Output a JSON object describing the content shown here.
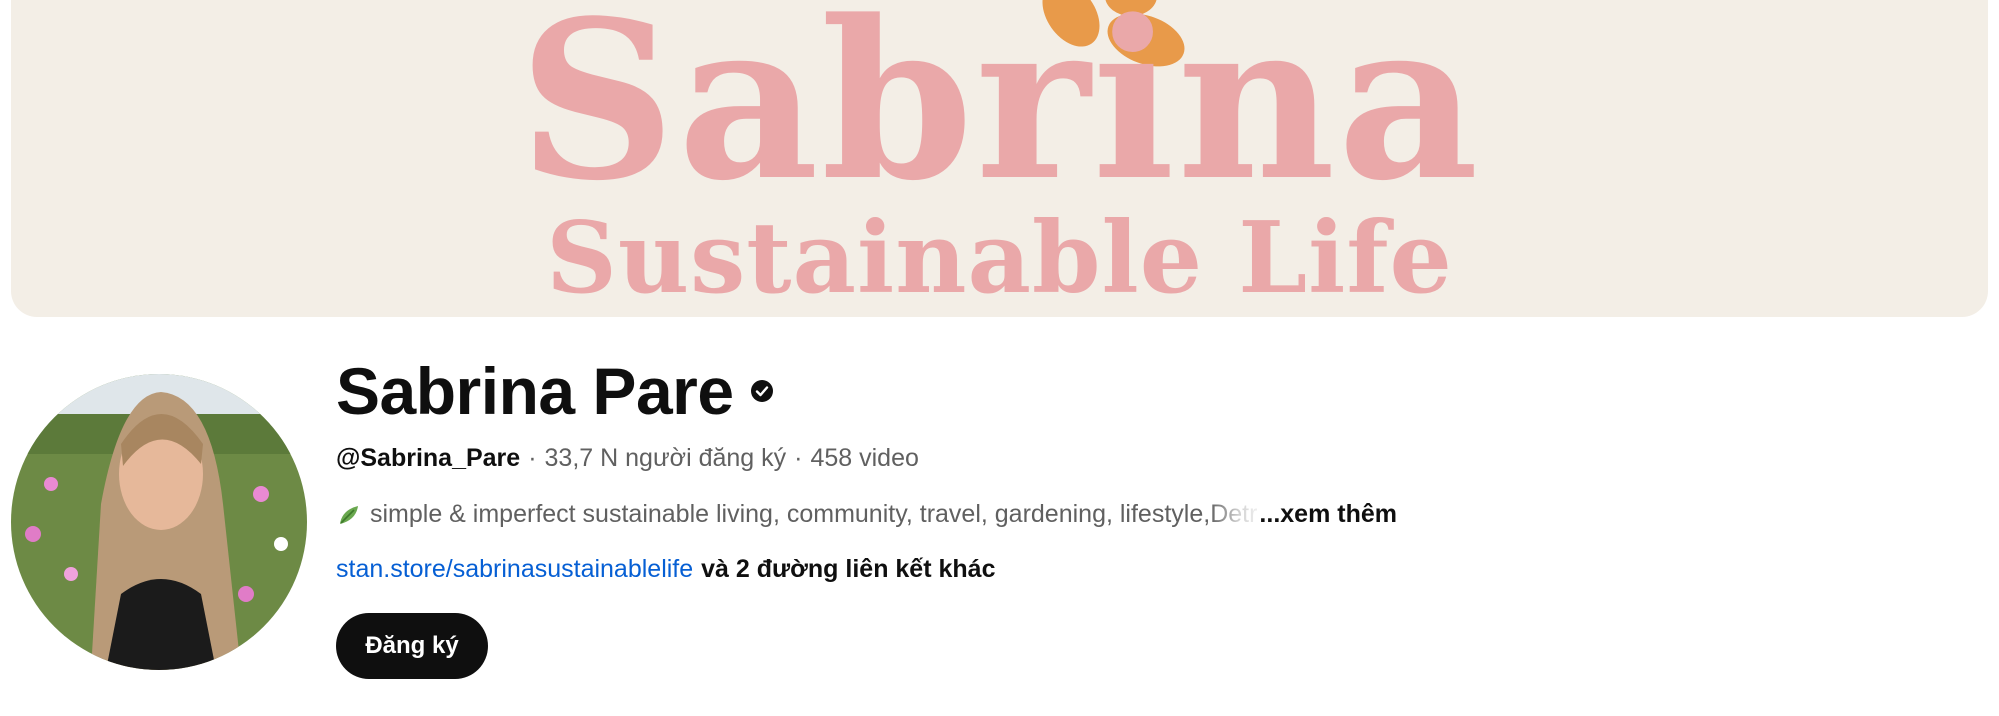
{
  "banner": {
    "title": "Sabrina",
    "subtitle": "Sustainable Life"
  },
  "channel": {
    "name": "Sabrina Pare",
    "handle": "@Sabrina_Pare",
    "separator": "·",
    "subscribers": "33,7 N người đăng ký",
    "videos": "458 video",
    "description": "simple & imperfect sustainable living, community,  travel, gardening, lifestyle, ",
    "description_faded": "Detr",
    "more_label": "...xem thêm",
    "link": "stan.store/sabrinasustainablelife",
    "more_links": "và 2 đường liên kết khác",
    "subscribe_label": "Đăng ký"
  },
  "colors": {
    "banner_bg": "#f3eee6",
    "banner_text": "#eaa8a9",
    "flower": "#e89a4a",
    "link": "#065fd4",
    "button_bg": "#0f0f0f"
  },
  "icons": {
    "verified": "verified-check-icon",
    "leaf": "leaf-emoji-icon"
  }
}
